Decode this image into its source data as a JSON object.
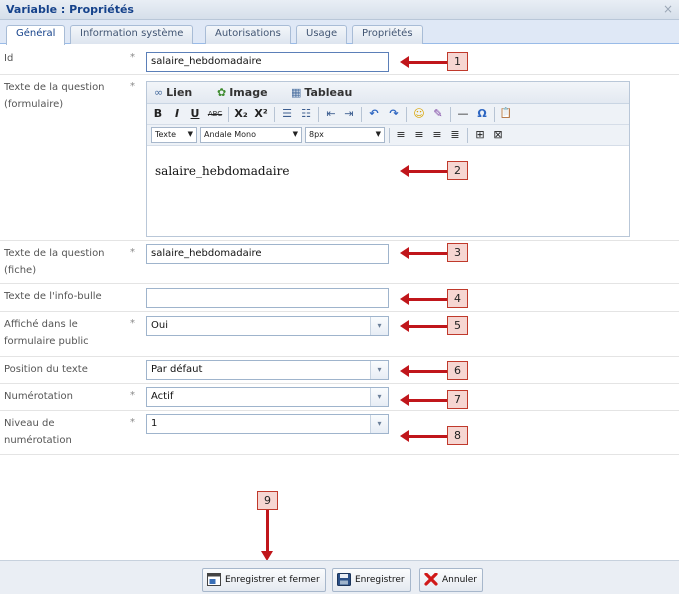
{
  "window": {
    "title": "Variable : Propriétés",
    "close_glyph": "×"
  },
  "tabs": [
    "Général",
    "Information système",
    "Autorisations",
    "Usage",
    "Propriétés"
  ],
  "required_mark": "*",
  "fields": {
    "id": {
      "label": "Id",
      "value": "salaire_hebdomadaire"
    },
    "question_form": {
      "label": "Texte de la question (formulaire)"
    },
    "question_fiche": {
      "label": "Texte de la question (fiche)",
      "value": "salaire_hebdomadaire"
    },
    "tooltip": {
      "label": "Texte de l'info-bulle",
      "value": ""
    },
    "public": {
      "label": "Affiché dans le formulaire public",
      "value": "Oui"
    },
    "position": {
      "label": "Position du texte",
      "value": "Par défaut"
    },
    "numbering": {
      "label": "Numérotation",
      "value": "Actif"
    },
    "numbering_level": {
      "label": "Niveau de numérotation",
      "value": "1"
    }
  },
  "editor": {
    "tab_link": "Lien",
    "tab_image": "Image",
    "tab_table": "Tableau",
    "format_select": "Texte",
    "font_select": "Andale Mono",
    "size_select": "8px",
    "toolbar_glyphs": {
      "bold": "B",
      "italic": "I",
      "underline": "U",
      "strike": "ABC",
      "subscript": "X₂",
      "superscript": "X²",
      "bullets": "☰",
      "numbered": "☷",
      "outdent": "⇤",
      "indent": "⇥",
      "undo": "↶",
      "redo": "↷",
      "emoticon": "☺",
      "spell": "✎",
      "hr": "—",
      "omega": "Ω",
      "paste": "📋",
      "align_left": "≡",
      "align_center": "≡",
      "align_right": "≡",
      "justify": "≣",
      "table_a": "⊞",
      "table_b": "⊠"
    },
    "content": "salaire_hebdomadaire"
  },
  "callouts": [
    "1",
    "2",
    "3",
    "4",
    "5",
    "6",
    "7",
    "8",
    "9"
  ],
  "buttons": {
    "save_close": "Enregistrer et fermer",
    "save": "Enregistrer",
    "cancel": "Annuler"
  },
  "colors": {
    "accent": "#15428b",
    "callout_arrow": "#c0161b"
  }
}
